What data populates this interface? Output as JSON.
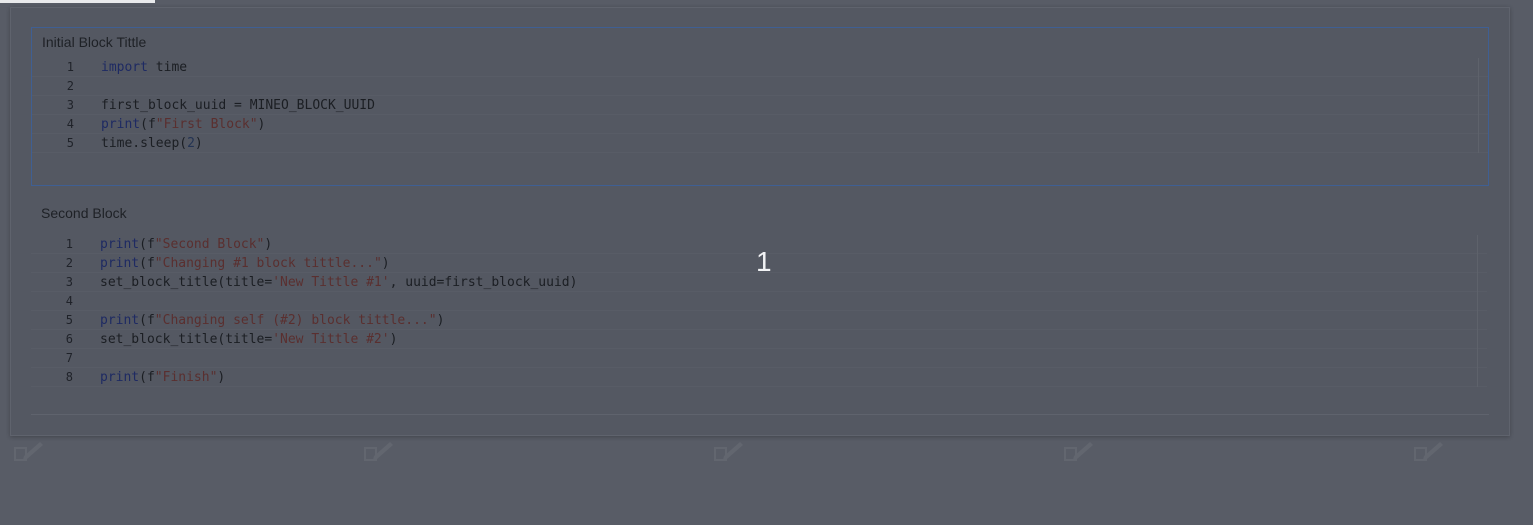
{
  "blocks": [
    {
      "title": "Initial Block Tittle",
      "lines": [
        {
          "n": "1",
          "tokens": [
            {
              "t": "import",
              "c": "kw"
            },
            {
              "t": " time",
              "c": ""
            }
          ]
        },
        {
          "n": "2",
          "tokens": []
        },
        {
          "n": "3",
          "tokens": [
            {
              "t": "first_block_uuid = MINEO_BLOCK_UUID",
              "c": ""
            }
          ]
        },
        {
          "n": "4",
          "tokens": [
            {
              "t": "print",
              "c": "kw"
            },
            {
              "t": "(f",
              "c": ""
            },
            {
              "t": "\"First Block\"",
              "c": "str"
            },
            {
              "t": ")",
              "c": ""
            }
          ]
        },
        {
          "n": "5",
          "tokens": [
            {
              "t": "time.sleep(",
              "c": ""
            },
            {
              "t": "2",
              "c": "num"
            },
            {
              "t": ")",
              "c": ""
            }
          ]
        }
      ]
    },
    {
      "title": "Second Block",
      "lines": [
        {
          "n": "1",
          "tokens": [
            {
              "t": "print",
              "c": "kw"
            },
            {
              "t": "(f",
              "c": ""
            },
            {
              "t": "\"Second Block\"",
              "c": "str"
            },
            {
              "t": ")",
              "c": ""
            }
          ]
        },
        {
          "n": "2",
          "tokens": [
            {
              "t": "print",
              "c": "kw"
            },
            {
              "t": "(f",
              "c": ""
            },
            {
              "t": "\"Changing #1 block tittle...\"",
              "c": "str"
            },
            {
              "t": ")",
              "c": ""
            }
          ]
        },
        {
          "n": "3",
          "tokens": [
            {
              "t": "set_block_title(title=",
              "c": ""
            },
            {
              "t": "'New Tittle #1'",
              "c": "str"
            },
            {
              "t": ", uuid=first_block_uuid)",
              "c": ""
            }
          ]
        },
        {
          "n": "4",
          "tokens": []
        },
        {
          "n": "5",
          "tokens": [
            {
              "t": "print",
              "c": "kw"
            },
            {
              "t": "(f",
              "c": ""
            },
            {
              "t": "\"Changing self (#2) block tittle...\"",
              "c": "str"
            },
            {
              "t": ")",
              "c": ""
            }
          ]
        },
        {
          "n": "6",
          "tokens": [
            {
              "t": "set_block_title(title=",
              "c": ""
            },
            {
              "t": "'New Tittle #2'",
              "c": "str"
            },
            {
              "t": ")",
              "c": ""
            }
          ]
        },
        {
          "n": "7",
          "tokens": []
        },
        {
          "n": "8",
          "tokens": [
            {
              "t": "print",
              "c": "kw"
            },
            {
              "t": "(f",
              "c": ""
            },
            {
              "t": "\"Finish\"",
              "c": "str"
            },
            {
              "t": ")",
              "c": ""
            }
          ]
        }
      ]
    }
  ],
  "overlay": {
    "counter": "1"
  },
  "icons": {
    "ghost": "edit-icon"
  },
  "colors": {
    "backdrop": "#585c66",
    "selected_border": "#3f5f93",
    "keyword": "#1e2a63",
    "string": "#5a2f2f"
  }
}
